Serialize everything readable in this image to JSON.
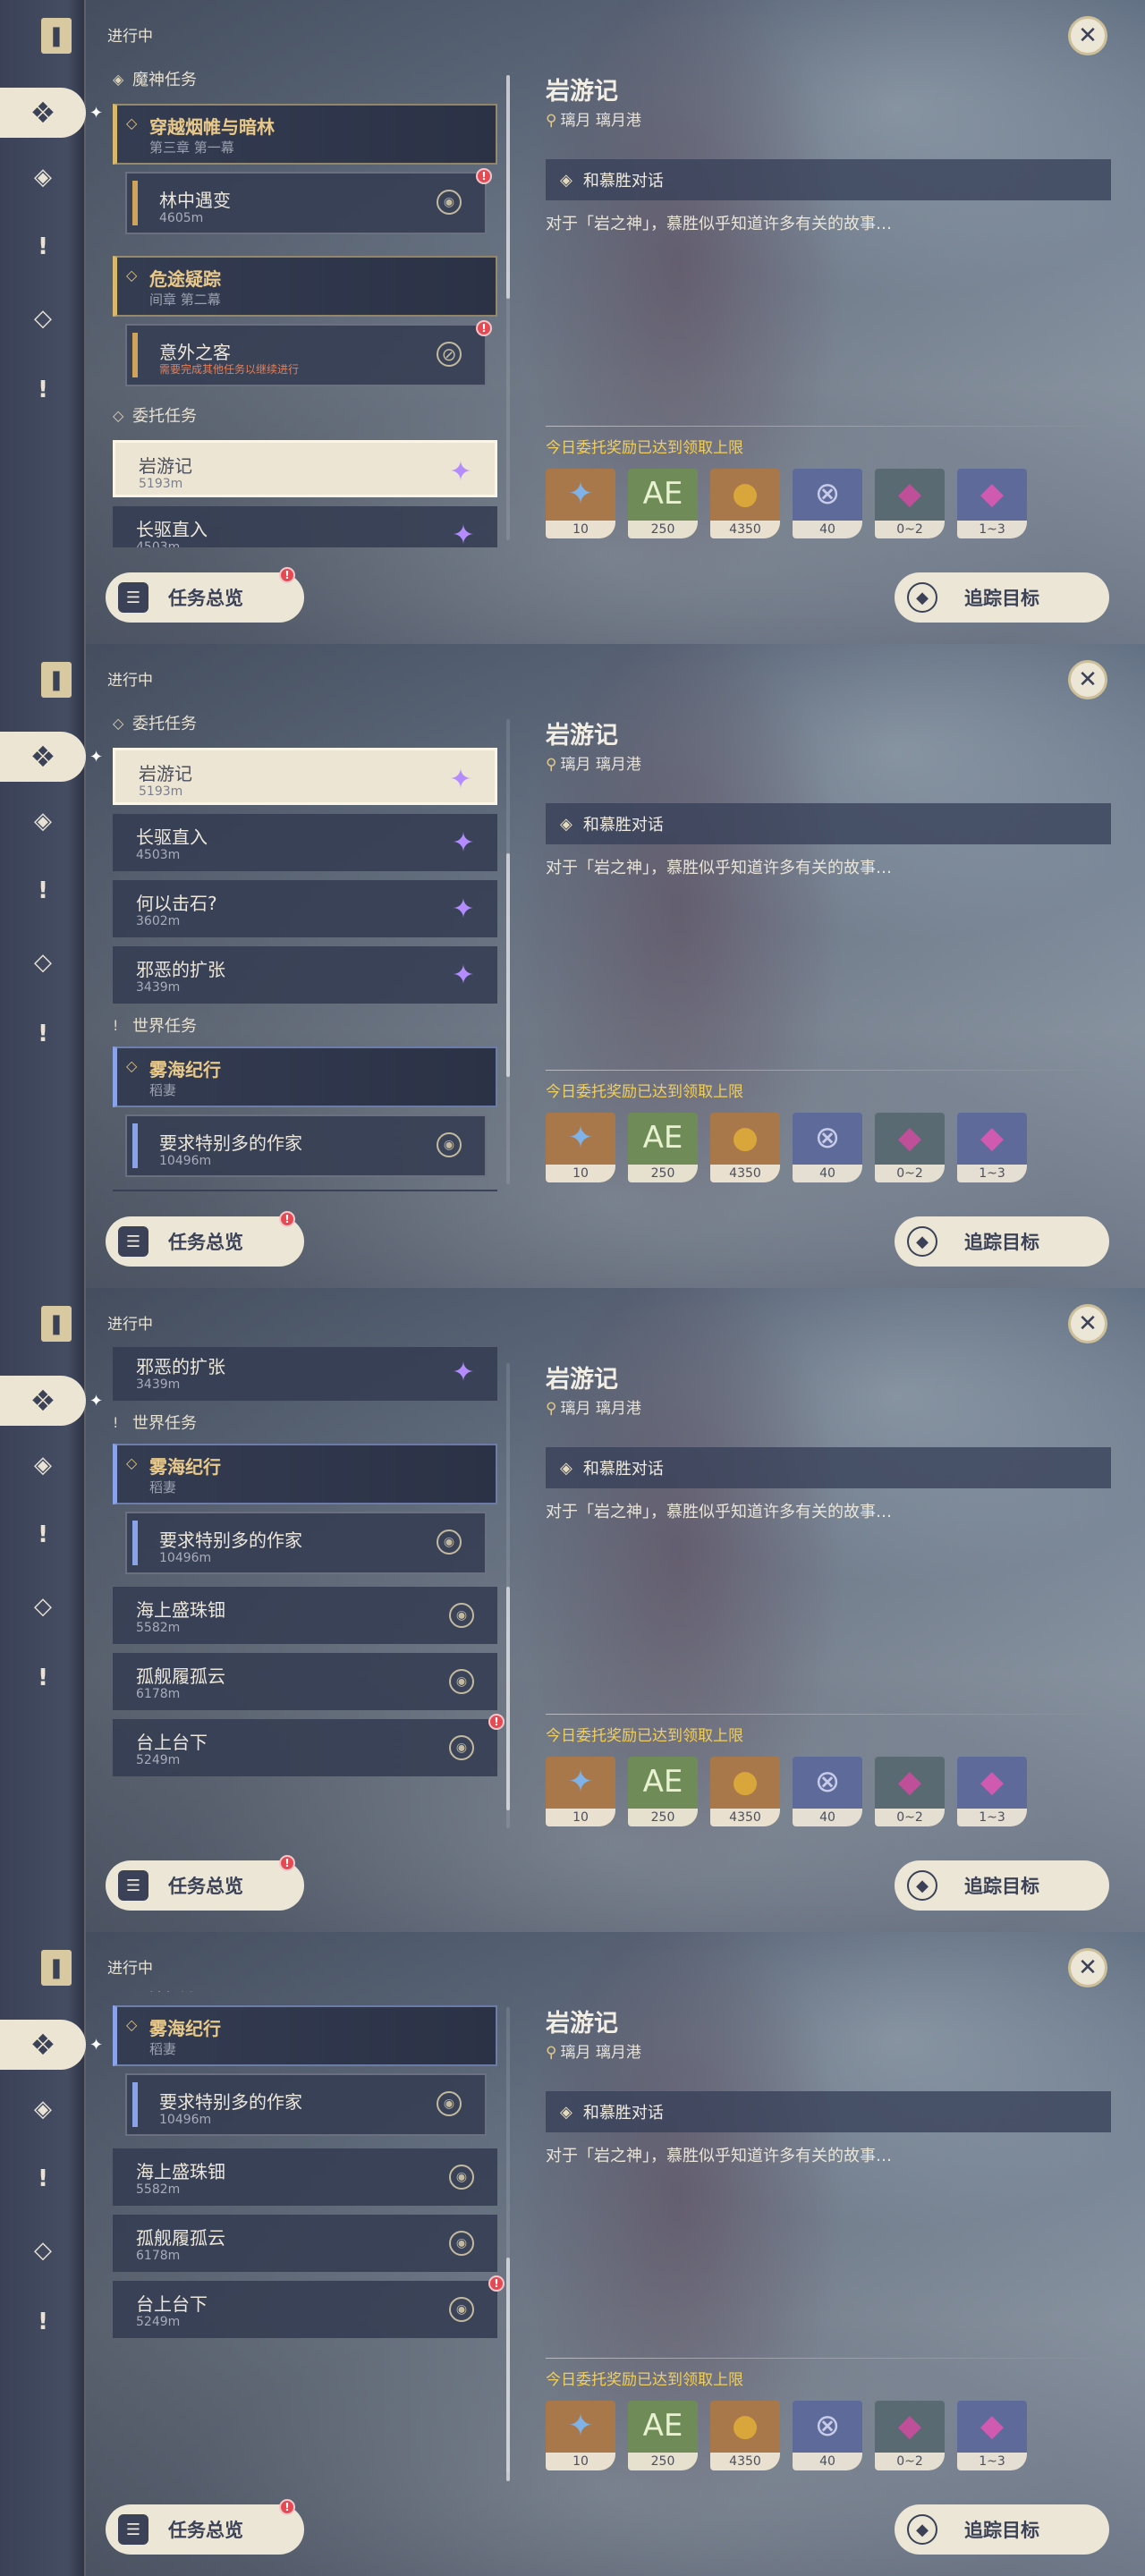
{
  "colors": {
    "gold": "#d8b86a",
    "accent_yellow": "#f2cf5a",
    "badge_red": "#e54a54",
    "purple": "#b48cff",
    "panel": "#343c52",
    "cream": "#ece6d6"
  },
  "header": {
    "in_progress": "进行中"
  },
  "rail_icons": [
    "quest-book-icon",
    "all-quests-icon",
    "archon-quest-icon",
    "world-quest-icon",
    "commission-icon",
    "event-quest-icon"
  ],
  "sections": {
    "archon": "魔神任务",
    "commission": "委托任务",
    "world": "世界任务"
  },
  "quests": {
    "ch1_title": "穿越烟帷与暗林",
    "ch1_sub": "第三章 第一幕",
    "ch1_item_title": "林中遇变",
    "ch1_item_dist": "4605m",
    "ch2_title": "危途疑踪",
    "ch2_sub": "间章 第二幕",
    "ch2_item_title": "意外之客",
    "ch2_item_warn": "需要完成其他任务以继续进行",
    "c1_title": "岩游记",
    "c1_dist": "5193m",
    "c2_title": "长驱直入",
    "c2_dist": "4503m",
    "c3_title": "何以击石?",
    "c3_dist": "3602m",
    "c4_title": "邪恶的扩张",
    "c4_dist": "3439m",
    "w_chapter_title": "雾海纪行",
    "w_chapter_sub": "稻妻",
    "w_item_title": "要求特别多的作家",
    "w_item_dist": "10496m",
    "w2_title": "海上盛珠钿",
    "w2_dist": "5582m",
    "w3_title": "孤舰履孤云",
    "w3_dist": "6178m",
    "w4_title": "台上台下",
    "w4_dist": "5249m"
  },
  "buttons": {
    "overview": "任务总览",
    "track": "追踪目标"
  },
  "detail": {
    "title": "岩游记",
    "location": "璃月 璃月港",
    "objective": "和慕胜对话",
    "description": "对于「岩之神」，慕胜似乎知道许多有关的故事…",
    "limit_notice": "今日委托奖励已达到领取上限"
  },
  "rewards": [
    {
      "name": "adventure-exp-icon",
      "qty": "10",
      "bg": "#a8784a",
      "glyph": "✦",
      "glyph_color": "#7fb2e6"
    },
    {
      "name": "companionship-exp-icon",
      "qty": "250",
      "bg": "#6f8b58",
      "glyph": "AE",
      "glyph_color": "#e9f2d0"
    },
    {
      "name": "mora-icon",
      "qty": "4350",
      "bg": "#a8784a",
      "glyph": "●",
      "glyph_color": "#d8a63a"
    },
    {
      "name": "intertwined-fate-icon",
      "qty": "40",
      "bg": "#5e6a9a",
      "glyph": "⊗",
      "glyph_color": "#c6cbe8"
    },
    {
      "name": "crystal-chunk-icon",
      "qty": "0~2",
      "bg": "#5a6a72",
      "glyph": "◆",
      "glyph_color": "#c04f9a"
    },
    {
      "name": "crystal-ore-icon",
      "qty": "1~3",
      "bg": "#5e6a9a",
      "glyph": "◆",
      "glyph_color": "#cf5ab0"
    }
  ]
}
